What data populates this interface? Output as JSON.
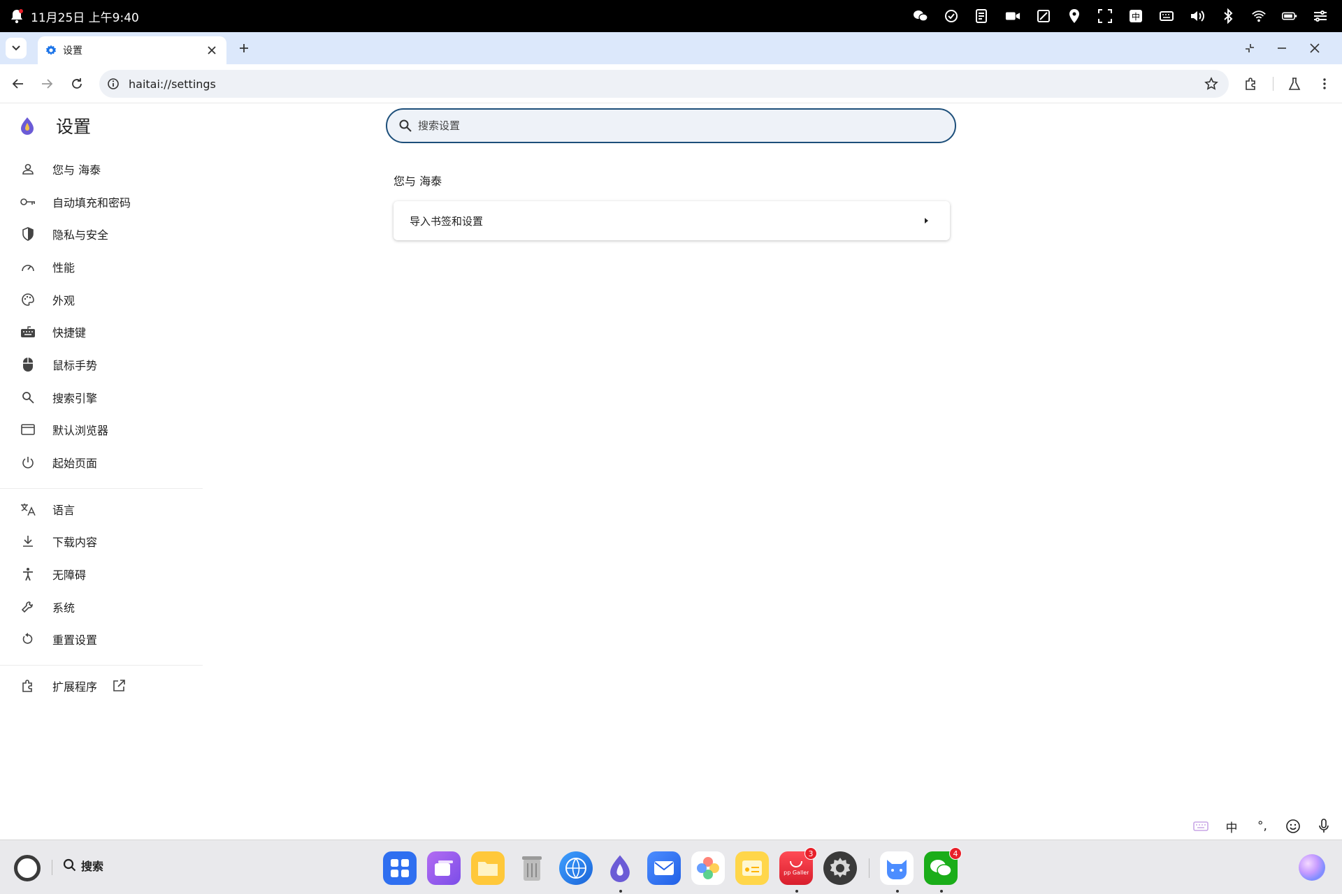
{
  "status_bar": {
    "datetime": "11月25日 上午9:40"
  },
  "tab": {
    "title": "设置"
  },
  "toolbar": {
    "url": "haitai://settings"
  },
  "settings": {
    "title": "设置"
  },
  "sidebar": {
    "group1": [
      "您与 海泰",
      "自动填充和密码",
      "隐私与安全",
      "性能",
      "外观",
      "快捷键",
      "鼠标手势",
      "搜索引擎",
      "默认浏览器",
      "起始页面"
    ],
    "group2": [
      "语言",
      "下载内容",
      "无障碍",
      "系统",
      "重置设置"
    ],
    "extensions": "扩展程序"
  },
  "search": {
    "placeholder": "搜索设置"
  },
  "main": {
    "section_title": "您与 海泰",
    "import_label": "导入书签和设置"
  },
  "ime": {
    "lang": "中",
    "punct": "°,"
  },
  "taskbar": {
    "search_label": "搜索",
    "app_gallery_badge": "3",
    "wechat_badge": "4",
    "app_gallery_text": "App Gallery"
  },
  "colors": {
    "accent": "#1d4f7a",
    "tab_strip": "#dce8fb"
  }
}
